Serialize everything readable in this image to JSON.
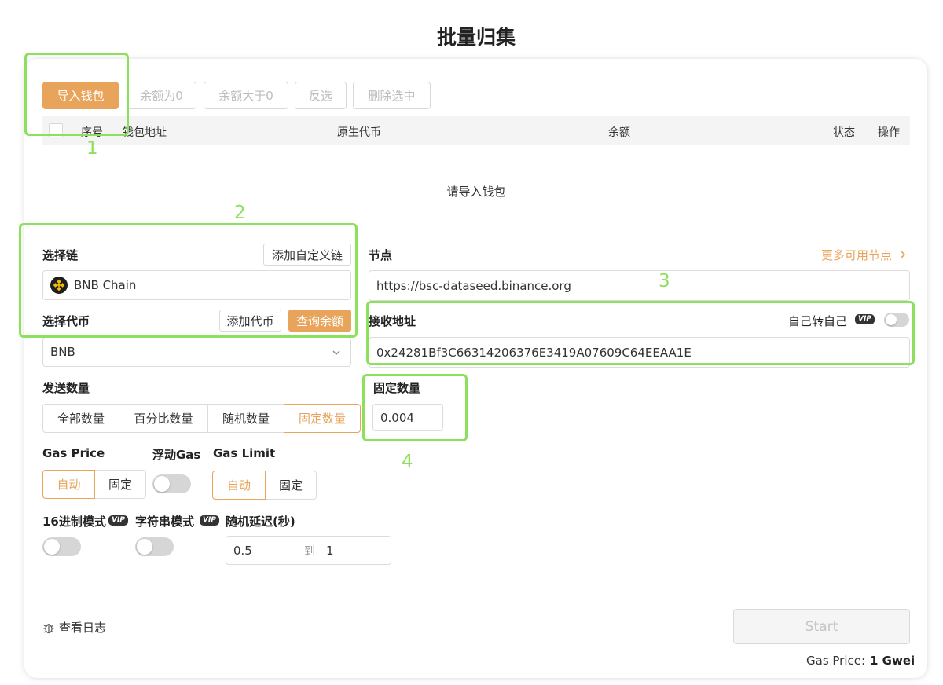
{
  "page": {
    "title": "批量归集"
  },
  "toolbar": {
    "import_wallet": "导入钱包",
    "balance_zero": "余额为0",
    "balance_gt_zero": "余额大于0",
    "invert_selection": "反选",
    "delete_selected": "删除选中"
  },
  "table": {
    "columns": [
      "序号",
      "钱包地址",
      "原生代币",
      "余额",
      "状态",
      "操作"
    ],
    "empty_text": "请导入钱包"
  },
  "chain": {
    "label": "选择链",
    "add_custom_chain": "添加自定义链",
    "selected": "BNB Chain"
  },
  "token": {
    "label": "选择代币",
    "add_token": "添加代币",
    "query_balance": "查询余额",
    "selected": "BNB"
  },
  "node": {
    "label": "节点",
    "more_nodes": "更多可用节点",
    "url": "https://bsc-dataseed.binance.org"
  },
  "receive": {
    "label": "接收地址",
    "self_transfer": "自己转自己",
    "vip": "VIP",
    "address": "0x24281Bf3C66314206376E3419A07609C64EEAA1E"
  },
  "send_amount": {
    "label": "发送数量",
    "options": [
      "全部数量",
      "百分比数量",
      "随机数量",
      "固定数量"
    ],
    "selected": "固定数量"
  },
  "fixed_amount": {
    "label": "固定数量",
    "value": "0.004"
  },
  "gas_price": {
    "label": "Gas Price",
    "options": [
      "自动",
      "固定"
    ],
    "selected": "自动"
  },
  "float_gas": {
    "label": "浮动Gas",
    "enabled": false
  },
  "gas_limit": {
    "label": "Gas Limit",
    "options": [
      "自动",
      "固定"
    ],
    "selected": "自动"
  },
  "hex_mode": {
    "label": "16进制模式",
    "vip": "VIP",
    "enabled": false
  },
  "string_mode": {
    "label": "字符串模式",
    "vip": "VIP",
    "enabled": false
  },
  "random_delay": {
    "label": "随机延迟(秒)",
    "min": "0.5",
    "to": "到",
    "max": "1"
  },
  "footer": {
    "view_log": "查看日志",
    "start": "Start",
    "gas_price_label": "Gas Price:",
    "gas_price_value": "1 Gwei"
  },
  "annotations": [
    "1",
    "2",
    "3",
    "4"
  ],
  "colors": {
    "accent": "#e8a45a",
    "annotation": "#8de05c"
  }
}
